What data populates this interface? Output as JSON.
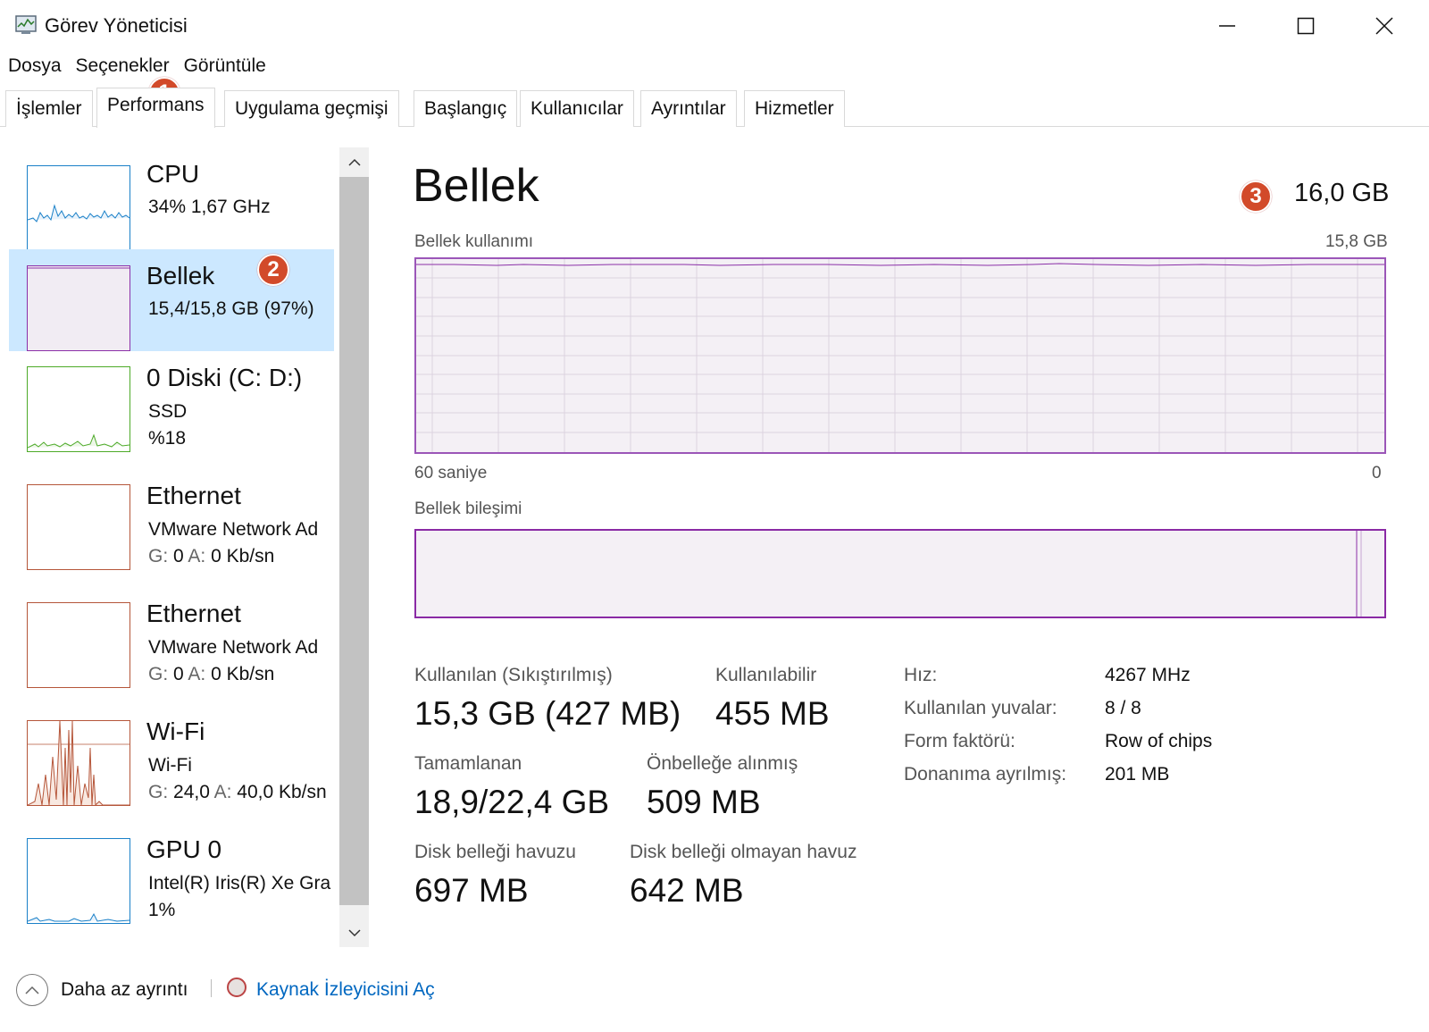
{
  "window": {
    "title": "Görev Yöneticisi",
    "icon": "task-manager-icon"
  },
  "menu": [
    "Dosya",
    "Seçenekler",
    "Görüntüle"
  ],
  "tabs": [
    {
      "label": "İşlemler",
      "active": false
    },
    {
      "label": "Performans",
      "active": true
    },
    {
      "label": "Uygulama geçmişi",
      "active": false
    },
    {
      "label": "Başlangıç",
      "active": false
    },
    {
      "label": "Kullanıcılar",
      "active": false
    },
    {
      "label": "Ayrıntılar",
      "active": false
    },
    {
      "label": "Hizmetler",
      "active": false
    }
  ],
  "sidebar": {
    "items": [
      {
        "name": "CPU",
        "line1": "34%  1,67 GHz",
        "line2": "",
        "color": "#1a80c8",
        "selected": false
      },
      {
        "name": "Bellek",
        "line1": "15,4/15,8 GB (97%)",
        "line2": "",
        "color": "#8b30a8",
        "selected": true
      },
      {
        "name": "0 Diski (C: D:)",
        "line1": "SSD",
        "line2": "%18",
        "color": "#4daa28",
        "selected": false
      },
      {
        "name": "Ethernet",
        "line1": "VMware Network Ad",
        "line2_g": "G:",
        "line2_gv": "0",
        "line2_a": "A:",
        "line2_av": "0 Kb/sn",
        "color": "#b5563a",
        "selected": false
      },
      {
        "name": "Ethernet",
        "line1": "VMware Network Ad",
        "line2_g": "G:",
        "line2_gv": "0",
        "line2_a": "A:",
        "line2_av": "0 Kb/sn",
        "color": "#b5563a",
        "selected": false
      },
      {
        "name": "Wi-Fi",
        "line1": "Wi-Fi",
        "line2_g": "G:",
        "line2_gv": "24,0",
        "line2_a": "A:",
        "line2_av": "40,0 Kb/sn",
        "color": "#b5563a",
        "selected": false
      },
      {
        "name": "GPU 0",
        "line1": "Intel(R) Iris(R) Xe Gra",
        "line2": "1%",
        "color": "#1a80c8",
        "selected": false
      }
    ]
  },
  "main": {
    "title": "Bellek",
    "total": "16,0 GB",
    "usage_label": "Bellek kullanımı",
    "usage_max": "15,8 GB",
    "axis_left": "60 saniye",
    "axis_right": "0",
    "composition_label": "Bellek bileşimi",
    "accent": "#8b30a8",
    "stats": {
      "used_label": "Kullanılan (Sıkıştırılmış)",
      "used_value": "15,3 GB (427 MB)",
      "available_label": "Kullanılabilir",
      "available_value": "455 MB",
      "committed_label": "Tamamlanan",
      "committed_value": "18,9/22,4 GB",
      "cached_label": "Önbelleğe alınmış",
      "cached_value": "509 MB",
      "paged_label": "Disk belleği havuzu",
      "paged_value": "697 MB",
      "nonpaged_label": "Disk belleği olmayan havuz",
      "nonpaged_value": "642 MB"
    },
    "specs": [
      {
        "label": "Hız:",
        "value": "4267 MHz"
      },
      {
        "label": "Kullanılan yuvalar:",
        "value": "8 / 8"
      },
      {
        "label": "Form faktörü:",
        "value": "Row of chips"
      },
      {
        "label": "Donanıma ayrılmış:",
        "value": "201 MB"
      }
    ]
  },
  "footer": {
    "less_details": "Daha az ayrıntı",
    "resource_monitor": "Kaynak İzleyicisini Aç"
  },
  "badges": [
    "1",
    "2",
    "3"
  ]
}
